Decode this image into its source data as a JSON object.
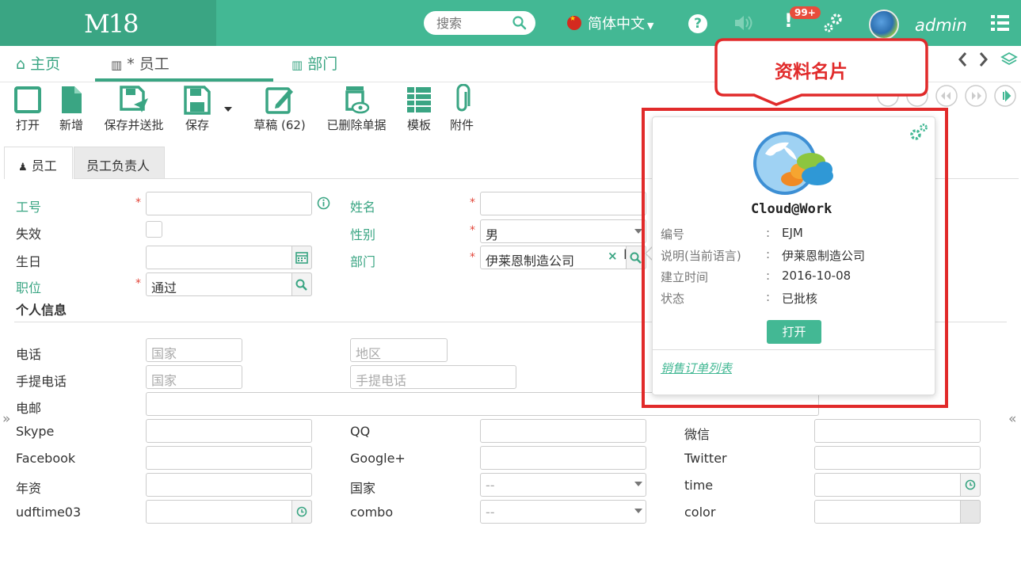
{
  "header": {
    "logo": "M18",
    "search_placeholder": "搜索",
    "language": "简体中文",
    "notification_count": "99+",
    "username": "admin"
  },
  "tabs": [
    {
      "label": "主页"
    },
    {
      "label": "* 员工"
    },
    {
      "label": "部门"
    }
  ],
  "toolbar": {
    "open": "打开",
    "new": "新增",
    "save_send": "保存并送批",
    "save": "保存",
    "draft": "草稿 (62)",
    "deleted": "已删除单据",
    "template": "模板",
    "attachment": "附件"
  },
  "form_tabs": {
    "employee": "员工",
    "manager": "员工负责人"
  },
  "form": {
    "code_label": "工号",
    "name_label": "姓名",
    "inactive_label": "失效",
    "gender_label": "性别",
    "gender_value": "男",
    "birthday_label": "生日",
    "dept_label": "部门",
    "dept_value": "伊莱恩制造公司",
    "position_label": "职位",
    "position_value": "通过",
    "personal_section": "个人信息",
    "phone_label": "电话",
    "phone_country_ph": "国家",
    "phone_area_ph": "地区",
    "mobile_label": "手提电话",
    "mobile_country_ph": "国家",
    "mobile_ph": "手提电话",
    "email_label": "电邮",
    "skype_label": "Skype",
    "qq_label": "QQ",
    "wechat_label": "微信",
    "facebook_label": "Facebook",
    "google_label": "Google+",
    "twitter_label": "Twitter",
    "seniority_label": "年资",
    "country_label": "国家",
    "country_value": "--",
    "time_label": "time",
    "udftime_label": "udftime03",
    "combo_label": "combo",
    "combo_value": "--",
    "color_label": "color"
  },
  "card": {
    "brand": "Cloud@Work",
    "rows": [
      {
        "key": "编号",
        "value": "EJM"
      },
      {
        "key": "说明(当前语言)",
        "value": "伊莱恩制造公司"
      },
      {
        "key": "建立时间",
        "value": "2016-10-08"
      },
      {
        "key": "状态",
        "value": "已批核"
      }
    ],
    "open_button": "打开",
    "link": "销售订单列表"
  },
  "annotation": {
    "callout": "资料名片"
  },
  "colors": {
    "brand_green": "#43b894",
    "annotation_red": "#e12a2a"
  }
}
